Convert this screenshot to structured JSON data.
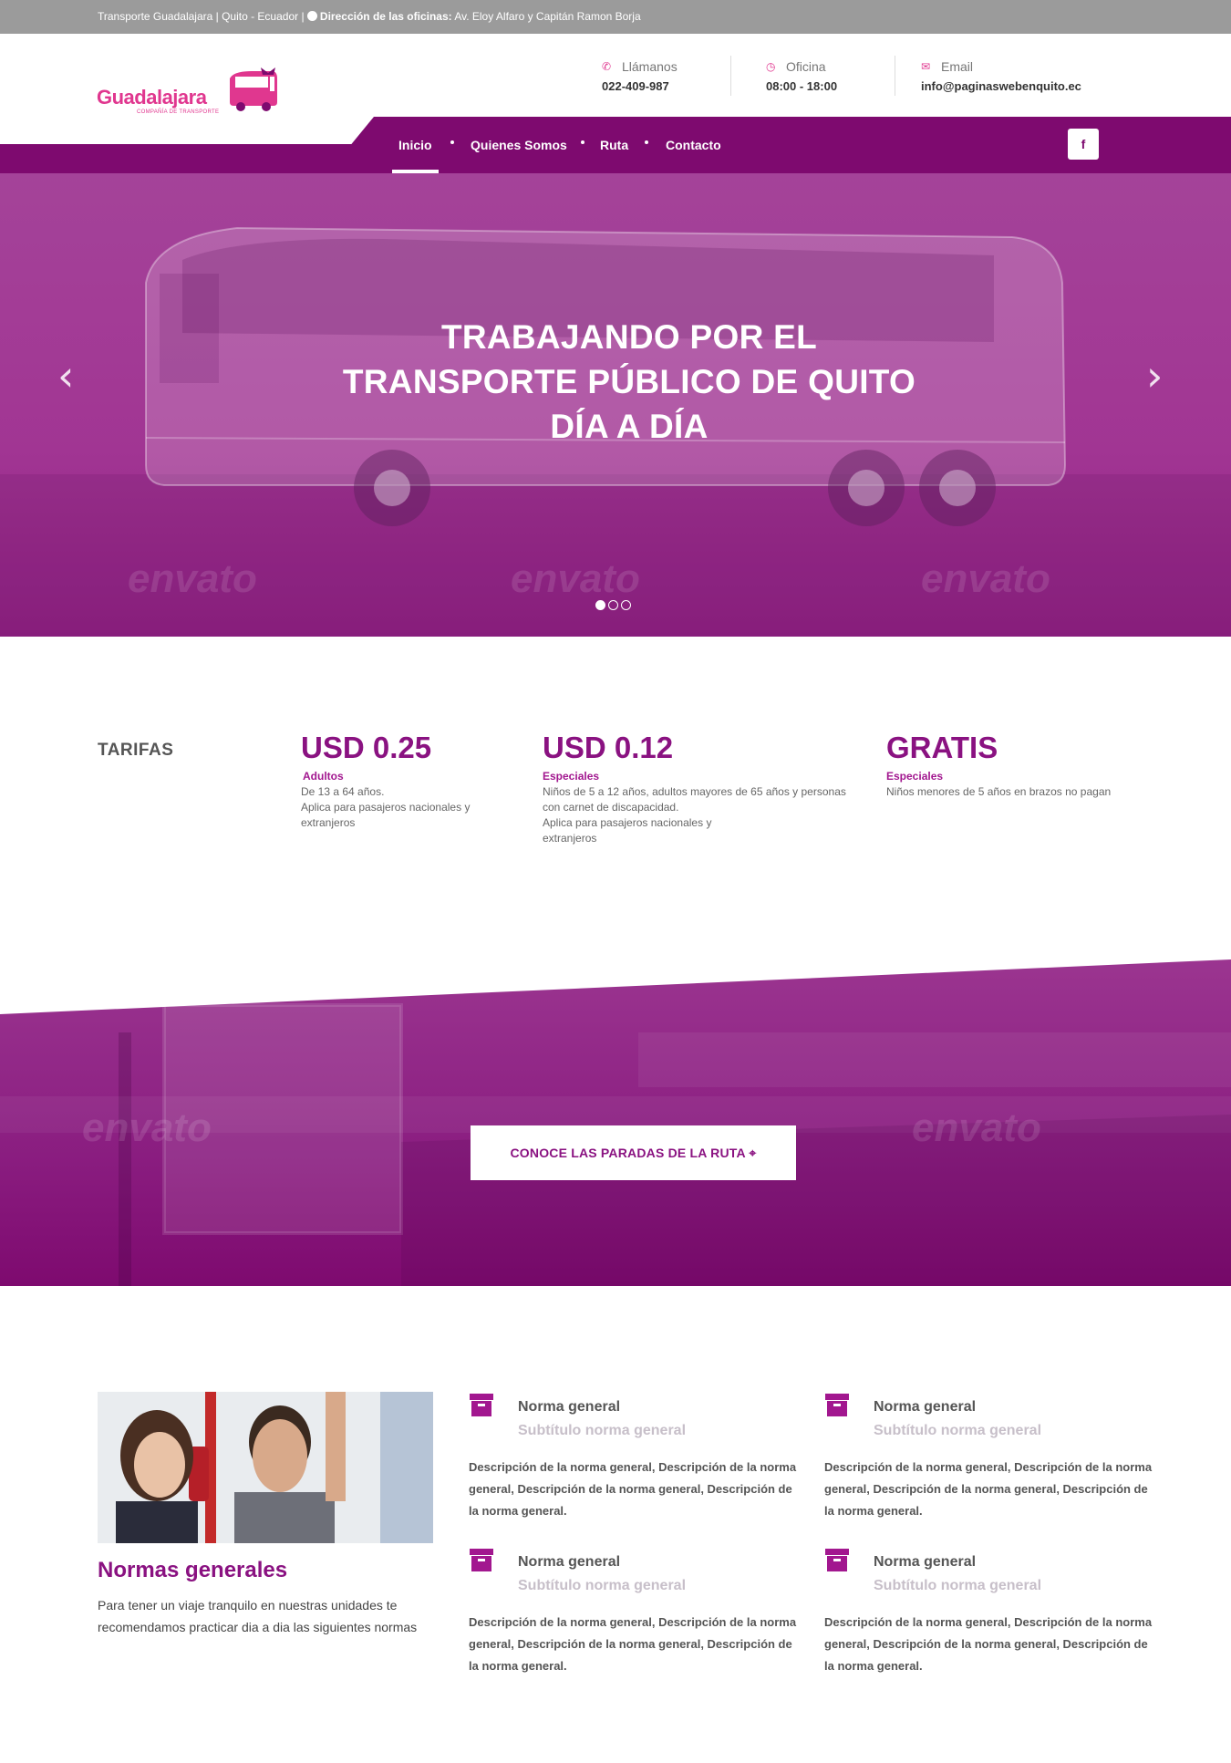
{
  "topbar": {
    "text": "Transporte Guadalajara | Quito - Ecuador |",
    "address_label": "Dirección de las oficinas:",
    "address": "Av. Eloy Alfaro y Capitán Ramon Borja"
  },
  "brand": {
    "name": "Guadalajara",
    "subtitle": "COMPAÑÍA DE TRANSPORTE",
    "accent": "#e0378f",
    "primary": "#7e0a6f"
  },
  "contacts": [
    {
      "icon": "phone-icon",
      "label": "Llámanos",
      "value": "022-409-987"
    },
    {
      "icon": "clock-icon",
      "label": "Oficina",
      "value": "08:00 - 18:00"
    },
    {
      "icon": "envelope-icon",
      "label": "Email",
      "value": "info@paginaswebenquito.ec"
    }
  ],
  "nav": {
    "items": [
      "Inicio",
      "Quienes Somos",
      "Ruta",
      "Contacto"
    ],
    "active": "Inicio",
    "social": "f"
  },
  "hero": {
    "line1": "TRABAJANDO POR EL",
    "line2": "TRANSPORTE PÚBLICO DE QUITO",
    "line3": "DÍA A DÍA",
    "slides": 3,
    "current_slide": 1,
    "prev": "‹",
    "next": "›",
    "watermark": "envato"
  },
  "tarifas": {
    "label": "TARIFAS",
    "items": [
      {
        "price": "USD 0.25",
        "category": "Adultos",
        "desc1": "De 13 a 64 años.",
        "desc2": "Aplica para pasajeros nacionales y extranjeros"
      },
      {
        "price": "USD 0.12",
        "category": "Especiales",
        "desc1": "Niños de 5 a 12 años, adultos mayores de 65 años y personas con carnet de discapacidad.",
        "desc2": "Aplica para pasajeros nacionales y extranjeros"
      },
      {
        "price": "GRATIS",
        "category": "Especiales",
        "desc1": "Niños menores de 5 años en brazos no pagan",
        "desc2": ""
      }
    ]
  },
  "cta": {
    "label": "CONOCE LAS PARADAS DE LA RUTA"
  },
  "normas": {
    "title": "Normas generales",
    "text": "Para tener un viaje tranquilo en nuestras unidades te recomendamos practicar dia a dia las siguientes normas",
    "items": [
      {
        "title": "Norma general",
        "subtitle": "Subtítulo norma general",
        "desc": "Descripción de la norma general, Descripción de la norma general, Descripción de la norma general, Descripción de la norma general."
      },
      {
        "title": "Norma general",
        "subtitle": "Subtítulo norma general",
        "desc": "Descripción de la norma general, Descripción de la norma general, Descripción de la norma general, Descripción de la norma general."
      },
      {
        "title": "Norma general",
        "subtitle": "Subtítulo norma general",
        "desc": "Descripción de la norma general, Descripción de la norma general, Descripción de la norma general, Descripción de la norma general."
      },
      {
        "title": "Norma general",
        "subtitle": "Subtítulo norma general",
        "desc": "Descripción de la norma general, Descripción de la norma general, Descripción de la norma general, Descripción de la norma general."
      }
    ]
  }
}
